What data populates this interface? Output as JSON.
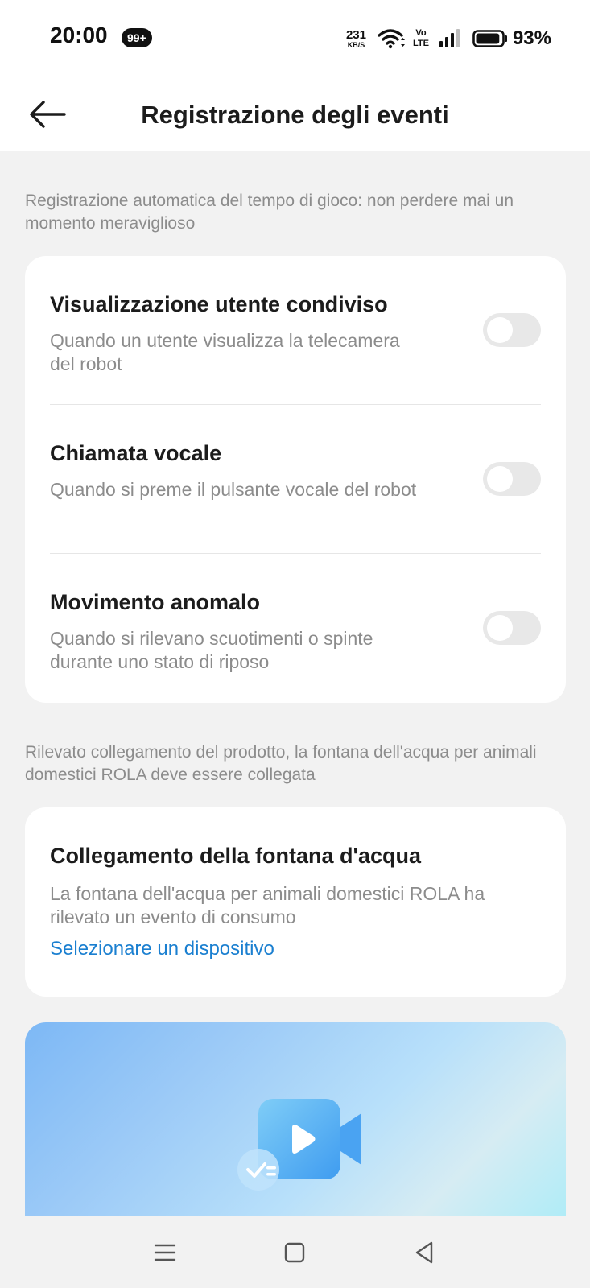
{
  "status_bar": {
    "time": "20:00",
    "notification_badge": "99+",
    "net_speed_value": "231",
    "net_speed_unit": "KB/S",
    "volte_top": "Vo",
    "volte_bottom": "LTE",
    "battery_percent": "93%",
    "battery_level": 0.93
  },
  "header": {
    "title": "Registrazione degli eventi"
  },
  "section1": {
    "description": "Registrazione automatica del tempo di gioco: non perdere mai un momento meraviglioso",
    "items": [
      {
        "title": "Visualizzazione utente condiviso",
        "description": "Quando un utente visualizza la telecamera del robot",
        "enabled": false
      },
      {
        "title": "Chiamata vocale",
        "description": "Quando si preme il pulsante vocale del robot",
        "enabled": false
      },
      {
        "title": "Movimento anomalo",
        "description": "Quando si rilevano scuotimenti o spinte durante uno stato di riposo",
        "enabled": false
      }
    ]
  },
  "section2": {
    "description": "Rilevato collegamento del prodotto, la fontana dell'acqua per animali domestici ROLA deve essere collegata",
    "card": {
      "title": "Collegamento della fontana d'acqua",
      "description": "La fontana dell'acqua per animali domestici ROLA ha rilevato un evento di consumo",
      "link_label": "Selezionare un dispositivo"
    }
  },
  "banner": {
    "icon": "video-camera-icon"
  },
  "colors": {
    "accent_link": "#1a7fd0",
    "background": "#f2f2f2",
    "card": "#ffffff",
    "toggle_off": "#e8e8e8"
  },
  "nav": {
    "icons": [
      "menu-icon",
      "home-square-icon",
      "back-triangle-icon"
    ]
  }
}
